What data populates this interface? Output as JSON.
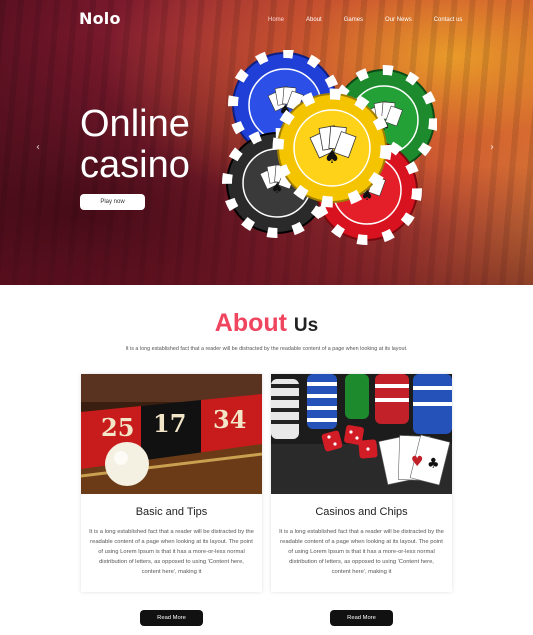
{
  "brand": {
    "name": "Nolo"
  },
  "nav": {
    "items": [
      {
        "label": "Home",
        "active": true
      },
      {
        "label": "About",
        "active": false
      },
      {
        "label": "Games",
        "active": false
      },
      {
        "label": "Our News",
        "active": false
      },
      {
        "label": "Contact us",
        "active": false
      }
    ]
  },
  "hero": {
    "title": "Online casino",
    "cta": "Play now",
    "prev_icon": "chevron-left-icon",
    "next_icon": "chevron-right-icon"
  },
  "about": {
    "title_highlight": "About",
    "title_rest": "Us",
    "subtitle": "It is a long established fact that a reader will be distracted by the readable content of a page when looking at its layout.",
    "cards": [
      {
        "title": "Basic and Tips",
        "text": "It is a long established fact that a reader will be distracted by the readable content of a page when looking at its layout. The point of using Lorem Ipsum is that it has a more-or-less normal distribution of letters, as opposed to using 'Content here, content here', making it",
        "button": "Read More",
        "image": "roulette-wheel"
      },
      {
        "title": "Casinos and Chips",
        "text": "It is a long established fact that a reader will be distracted by the readable content of a page when looking at its layout. The point of using Lorem Ipsum is that it has a more-or-less normal distribution of letters, as opposed to using 'Content here, content here', making it",
        "button": "Read More",
        "image": "chips-dice-cards"
      }
    ]
  },
  "colors": {
    "accent_pink": "#f0455f",
    "hero_red": "#b3303c",
    "button_dark": "#111111"
  }
}
